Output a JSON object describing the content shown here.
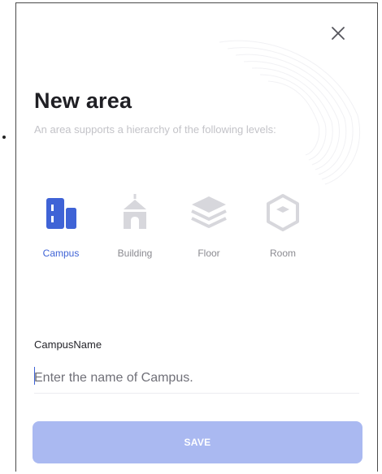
{
  "dialog": {
    "title": "New area",
    "subtitle": "An area supports a hierarchy of the following levels:"
  },
  "levels": [
    {
      "label": "Campus",
      "icon": "campus-icon",
      "selected": true
    },
    {
      "label": "Building",
      "icon": "building-icon",
      "selected": false
    },
    {
      "label": "Floor",
      "icon": "floor-icon",
      "selected": false
    },
    {
      "label": "Room",
      "icon": "room-icon",
      "selected": false
    }
  ],
  "form": {
    "field_label": "CampusName",
    "placeholder": "Enter the name of Campus.",
    "value": ""
  },
  "actions": {
    "save_label": "SAVE"
  },
  "colors": {
    "accent": "#3f63d6",
    "inactive_icon": "#d7d7dc",
    "save_button_bg": "#aab9f1",
    "title": "#1f1f24"
  }
}
